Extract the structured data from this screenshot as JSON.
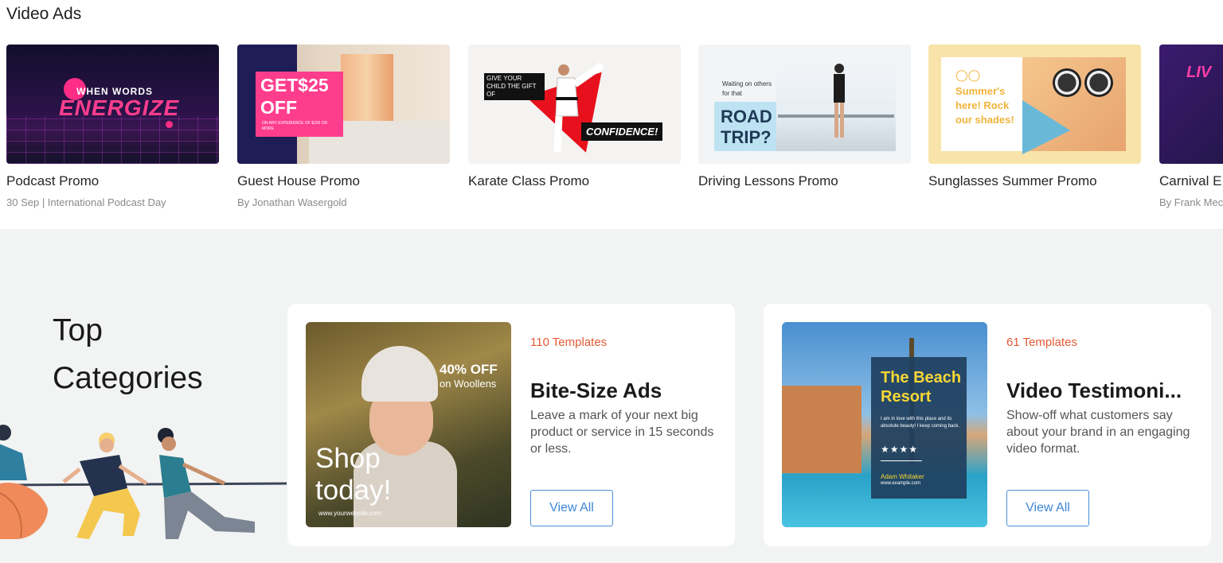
{
  "video_ads": {
    "title": "Video Ads",
    "cards": [
      {
        "title": "Podcast Promo",
        "subtitle": "30 Sep | International Podcast Day",
        "thumb_text": [
          "WHEN WORDS",
          "ENERGIZE"
        ]
      },
      {
        "title": "Guest House Promo",
        "subtitle": "By Jonathan Wasergold",
        "thumb_text": [
          "GET$25",
          "OFF",
          "ON ANY EXPERIENCE OF $150 OR MORE"
        ]
      },
      {
        "title": "Karate Class Promo",
        "subtitle": "",
        "thumb_text": [
          "GIVE YOUR CHILD THE GIFT OF",
          "CONFIDENCE!"
        ]
      },
      {
        "title": "Driving Lessons Promo",
        "subtitle": "",
        "thumb_text": [
          "Waiting on others for that",
          "ROAD",
          "TRIP?"
        ]
      },
      {
        "title": "Sunglasses Summer Promo",
        "subtitle": "",
        "thumb_text": [
          "Summer's here! Rock our shades!"
        ]
      },
      {
        "title": "Carnival E",
        "subtitle": "By Frank Mec",
        "thumb_text": [
          "LIV"
        ]
      }
    ]
  },
  "top_categories": {
    "heading": [
      "Top",
      "Categories"
    ],
    "categories": [
      {
        "count": "110 Templates",
        "title": "Bite-Size Ads",
        "description": "Leave a mark of your next big product or service in 15 seconds or less.",
        "button": "View All",
        "image_text": [
          "40% OFF",
          "on Woollens",
          "Shop",
          "today!",
          "www.yourwebsite.com"
        ]
      },
      {
        "count": "61 Templates",
        "title": "Video Testimoni...",
        "description": "Show-off what customers say about your brand in an engaging video format.",
        "button": "View All",
        "image_text": [
          "The Beach",
          "Resort",
          "I am in love with this place and its absolute beauty! I keep coming back.",
          "★★★★",
          "Adam Whitaker",
          "www.example.com"
        ]
      }
    ]
  },
  "colors": {
    "accent_orange": "#e45b35",
    "button_blue": "#3d86d6",
    "band_gray": "#f2f3f3"
  }
}
